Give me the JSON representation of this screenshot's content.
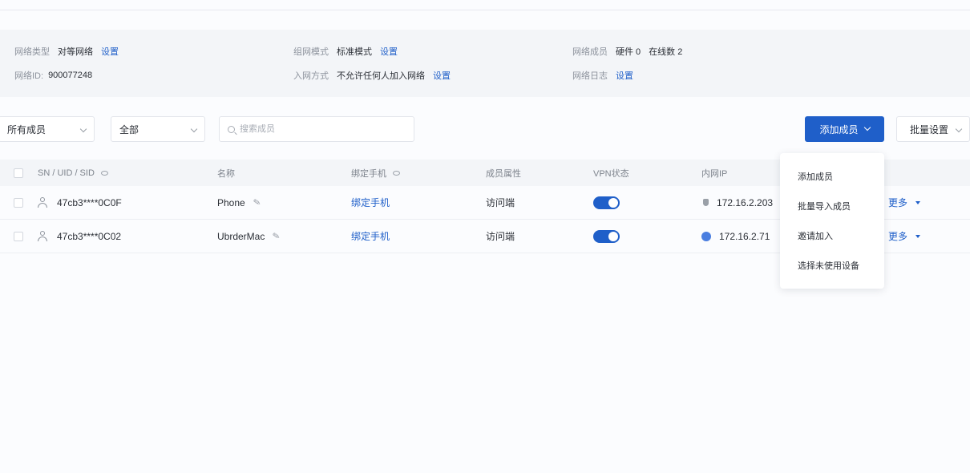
{
  "info": {
    "c1r1_label": "网络类型",
    "c1r1_value": "对等网络",
    "c1r1_link": "设置",
    "c1r2_label": "网络ID:",
    "c1r2_value": "900077248",
    "c2r1_label": "组网模式",
    "c2r1_value": "标准模式",
    "c2r1_link": "设置",
    "c2r2_label": "入网方式",
    "c2r2_value": "不允许任何人加入网络",
    "c2r2_link": "设置",
    "c3r1_label": "网络成员",
    "c3r1_value_a": "硬件 0",
    "c3r1_value_b": "在线数 2",
    "c3r2_label": "网络日志",
    "c3r2_link": "设置"
  },
  "toolbar": {
    "status_filter": "所有成员",
    "type_filter": "全部",
    "search_placeholder": "搜索成员",
    "add_button": "添加成员",
    "export_button": "批量设置"
  },
  "table": {
    "headers": {
      "id": "SN / UID / SID",
      "name": "名称",
      "bind": "绑定手机",
      "member_type": "成员属性",
      "vpn": "VPN状态",
      "ip": "内网IP"
    },
    "rows": [
      {
        "id": "47cb3****0C0F",
        "name": "Phone",
        "bind": "绑定手机",
        "member_type": "访问端",
        "vpn_on": true,
        "os": "apple",
        "ip": "172.16.2.203",
        "action": "更多"
      },
      {
        "id": "47cb3****0C02",
        "name": "UbrderMac",
        "bind": "绑定手机",
        "member_type": "访问端",
        "vpn_on": true,
        "os": "circle",
        "ip": "172.16.2.71",
        "action": "更多"
      }
    ]
  },
  "dropdown": {
    "items": [
      "添加成员",
      "批量导入成员",
      "邀请加入",
      "选择未使用设备"
    ]
  },
  "colors": {
    "accent": "#1f5fc9",
    "panel": "#f3f5f8"
  }
}
